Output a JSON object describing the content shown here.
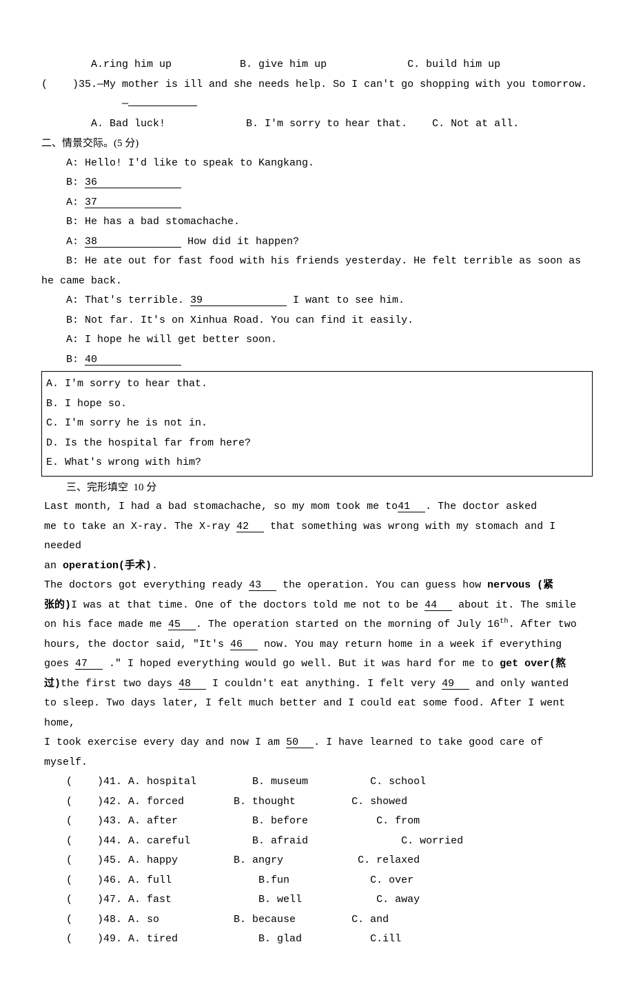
{
  "q_options_row": "        A.ring him up           B. give him up             C. build him up",
  "q35": {
    "prefix": "(    )35.—My mother is ill and she needs help. So I can't go shopping with you tomorrow.",
    "dash_line": "         —",
    "opts": "        A. Bad luck!             B. I'm sorry to hear that.    C. Not at all."
  },
  "section2_title": "二、情景交际。(5 分)",
  "dialog": {
    "a1": "A: Hello! I'd like to speak to Kangkang.",
    "b1_prefix": "B:  ",
    "b1_num": "36",
    "a2_prefix": "A:  ",
    "a2_num": "37",
    "b2": "B: He has a bad stomachache.",
    "a3_prefix": "A:  ",
    "a3_num": "38",
    "a3_suffix": " How did it happen?",
    "b3_p1": "    B: He ate out for fast food with his friends yesterday. He felt terrible as soon as",
    "b3_p2": "he came back.",
    "a4_prefix": "A: That's terrible.  ",
    "a4_num": "39",
    "a4_suffix": " I want to see him.",
    "b4": "B: Not far. It's on Xinhua Road. You can find it easily.",
    "a5": "A: I hope he will get better soon.",
    "b5_prefix": "B:  ",
    "b5_num": "40"
  },
  "box": {
    "a": "A. I'm sorry to hear that.",
    "b": "B. I hope so.",
    "c": "C. I'm sorry he is not in.",
    "d": "D. Is the hospital far from here?",
    "e": "E. What's wrong with him?"
  },
  "section3_title": "三、完形填空  10 分",
  "cloze": {
    "p1_a": "     Last month, I had a bad stomachache, so my mom took me to",
    "p1_b": ". The doctor asked",
    "p2_a": "me to take an X-ray. The X-ray ",
    "p2_b": " that something was wrong with my stomach and I needed",
    "p3_a": "an ",
    "p3_op": "operation(手术)",
    "p3_b": ".",
    "p4_a": "    The doctors got everything ready ",
    "p4_b": " the operation. You can guess how ",
    "p4_nerv": "nervous (紧",
    "p5_a": "张的)",
    "p5_b": "I was at that time. One of the doctors told me not to be ",
    "p5_c": " about it. The smile",
    "p6_a": "on his face made me ",
    "p6_b": ". The operation started on the morning of July 16",
    "p6_c": ". After two",
    "p7_a": "hours, the doctor said, \"It's ",
    "p7_b": " now. You may return home in a week if everything",
    "p8_a": "goes ",
    "p8_b": " .\" I hoped everything would go well. But it was hard for me to ",
    "p8_go": "get over(熬",
    "p9_a": "过)",
    "p9_b": "the first two days  ",
    "p9_c": " I couldn't eat anything. I felt very ",
    "p9_d": " and only wanted",
    "p10": "to sleep. Two days later, I felt much better and I could eat some food. After I went home,",
    "p11_a": "I took exercise every day and now I am ",
    "p11_b": ". I have learned to take good care of myself.",
    "b41": "  41  ",
    "b42": "  42  ",
    "b43": "  43  ",
    "b44": "  44  ",
    "b45": "  45  ",
    "b46": "  46  ",
    "b47": "  47  ",
    "b48": "  48  ",
    "b49": "  49  ",
    "b50": "  50  "
  },
  "opts": {
    "r41": "(    )41. A. hospital         B. museum          C. school",
    "r42": "(    )42. A. forced        B. thought         C. showed",
    "r43": "(    )43. A. after            B. before           C. from",
    "r44": "(    )44. A. careful          B. afraid               C. worried",
    "r45": "(    )45. A. happy         B. angry            C. relaxed",
    "r46": "(    )46. A. full              B.fun             C. over",
    "r47": "(    )47. A. fast              B. well            C. away",
    "r48": "(    )48. A. so            B. because         C. and",
    "r49": "(    )49. A. tired             B. glad           C.ill"
  }
}
